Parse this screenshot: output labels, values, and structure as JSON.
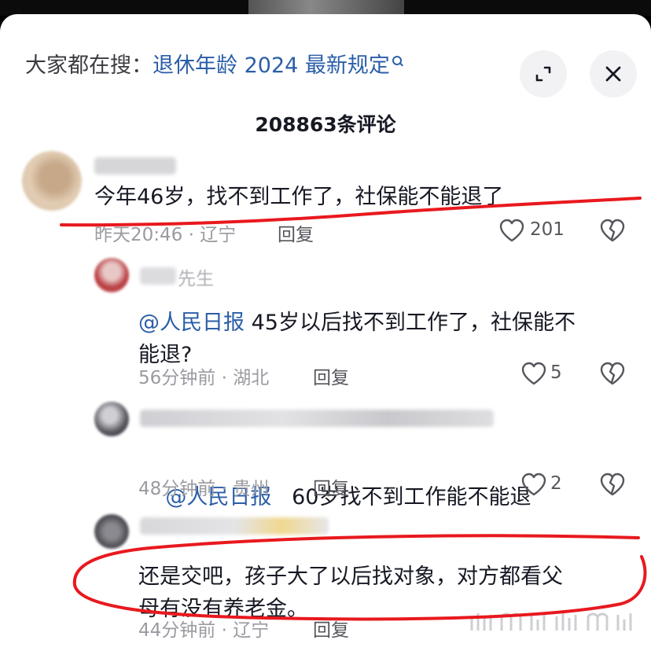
{
  "header": {
    "search_prefix": "大家都在搜：",
    "search_term": "退休年龄 2024 最新规定",
    "comment_count": "208863条评论"
  },
  "comments": [
    {
      "text": "今年46岁，找不到工作了，社保能不能退了",
      "meta": "昨天20:46 · 辽宁",
      "reply": "回复",
      "likes": "201"
    },
    {
      "name_partial": "先生",
      "mention": "@人民日报",
      "text_line1": " 45岁以后找不到工作了，社保能不",
      "text_line2": "能退?",
      "meta": "56分钟前 · 湖北",
      "reply": "回复",
      "likes": "5"
    },
    {
      "mention": "@人民日报",
      "text": "   60岁找不到工作能不能退",
      "meta": "48分钟前 · 贵州",
      "reply": "回复",
      "likes": "2"
    },
    {
      "text_line1": "还是交吧，孩子大了以后找对象，对方都看父",
      "text_line2": "母有没有养老金。",
      "meta": "44分钟前 · 辽宁",
      "reply": "回复"
    }
  ],
  "colors": {
    "accent_link": "#2b5ea8",
    "annotation_red": "#e8191e",
    "text_primary": "#161823",
    "text_secondary": "#9a9aa2"
  },
  "icons": [
    "search-icon",
    "expand-icon",
    "close-icon",
    "heart-icon",
    "broken-heart-icon"
  ]
}
